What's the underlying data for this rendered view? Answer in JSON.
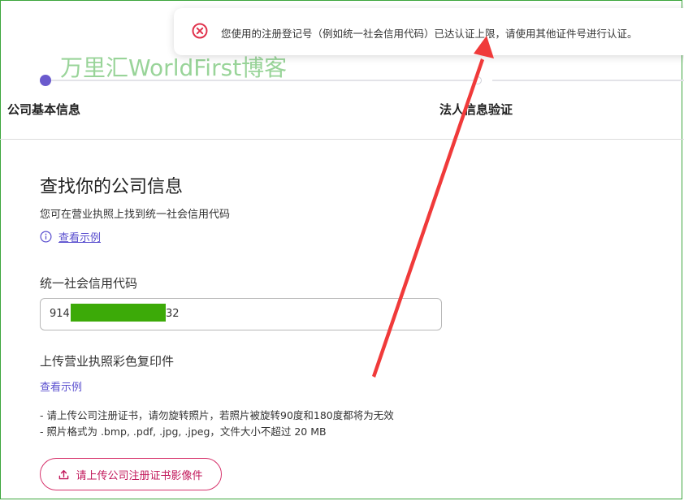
{
  "toast": {
    "message": "您使用的注册登记号（例如统一社会信用代码）已达认证上限，请使用其他证件号进行认证。",
    "icon": "error-circle-icon",
    "icon_color": "#e0314b"
  },
  "watermark": {
    "text": "万里汇WorldFirst博客"
  },
  "stepper": {
    "steps": [
      {
        "label": "公司基本信息",
        "active": true
      },
      {
        "label": "法人信息验证",
        "active": false
      }
    ],
    "active_color": "#6a5acd"
  },
  "main": {
    "title": "查找你的公司信息",
    "subtitle": "您可在营业执照上找到统一社会信用代码",
    "example_link": "查看示例",
    "credit_code": {
      "label": "统一社会信用代码",
      "value_prefix": "914",
      "value_suffix": "32"
    },
    "upload": {
      "label": "上传营业执照彩色复印件",
      "example_link": "查看示例",
      "notes": [
        "- 请上传公司注册证书，请勿旋转照片，若照片被旋转90度和180度都将为无效",
        "- 照片格式为 .bmp, .pdf, .jpg, .jpeg，文件大小不超过 20 MB"
      ],
      "button_label": "请上传公司注册证书影像件"
    }
  },
  "colors": {
    "link": "#5a4fcf",
    "accent_pink": "#c2185b",
    "mask_green": "#3caa08",
    "arrow_red": "#f03a3a"
  }
}
